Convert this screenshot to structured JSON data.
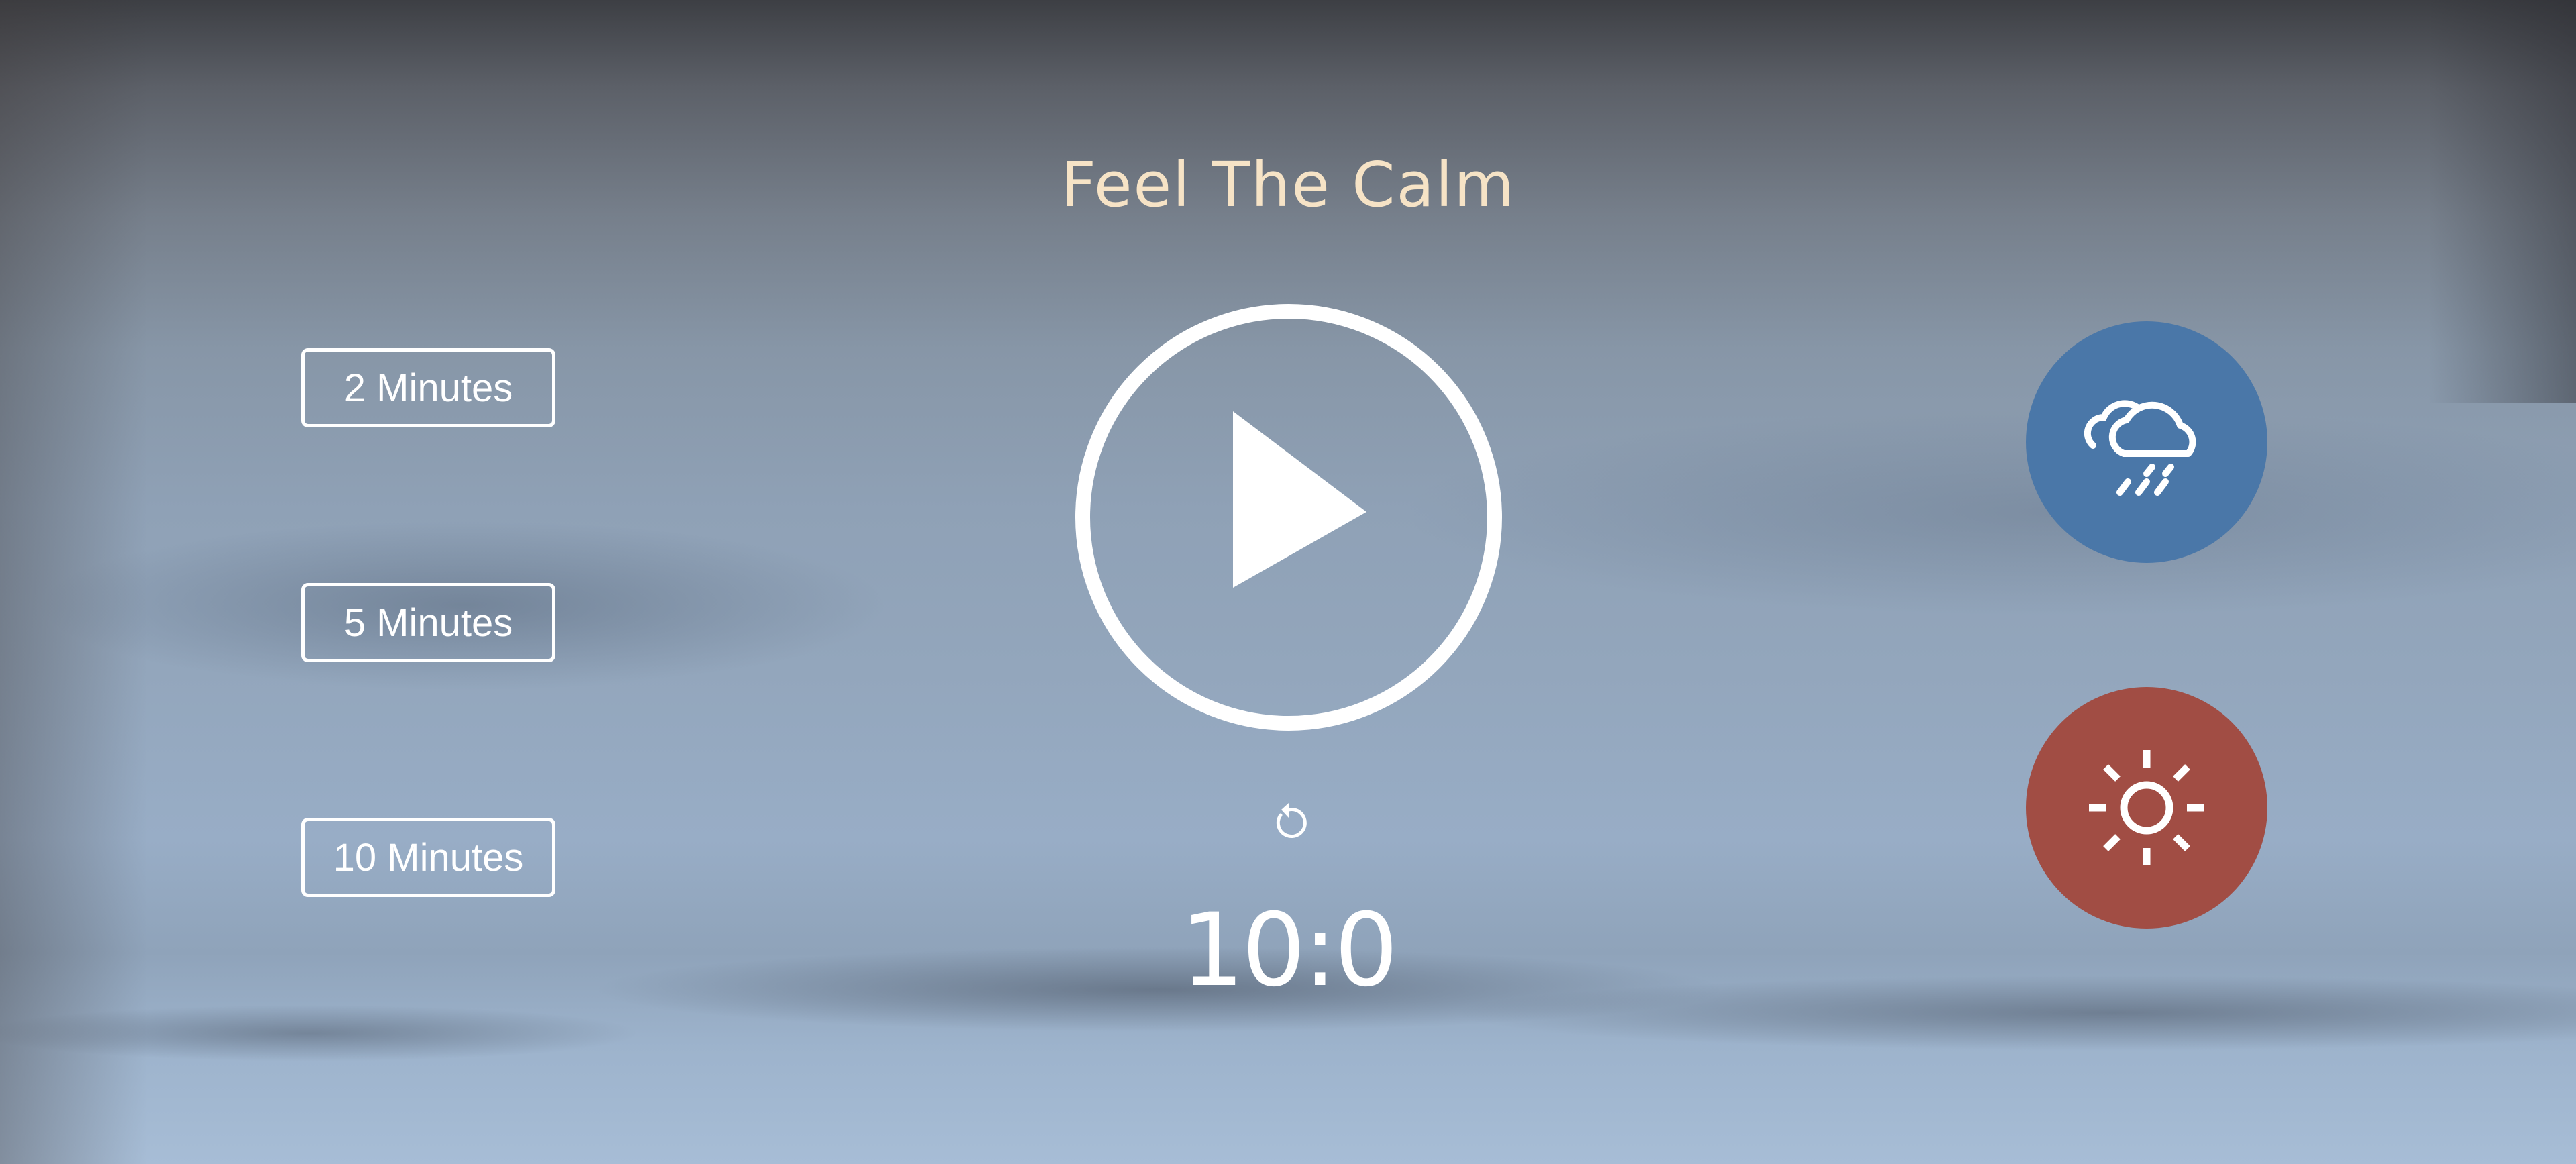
{
  "app": {
    "title": "Feel The Calm"
  },
  "durations": [
    {
      "label": "2 Minutes"
    },
    {
      "label": "5 Minutes"
    },
    {
      "label": "10 Minutes"
    }
  ],
  "player": {
    "play_icon": "play-icon",
    "replay_icon": "replay-icon",
    "timer": "10:0"
  },
  "sounds": [
    {
      "icon": "rain-cloud-icon",
      "color": "#4a77a8"
    },
    {
      "icon": "sun-icon",
      "color": "#a14d44"
    }
  ],
  "colors": {
    "title": "#f6e3c6",
    "foreground": "#ffffff"
  }
}
